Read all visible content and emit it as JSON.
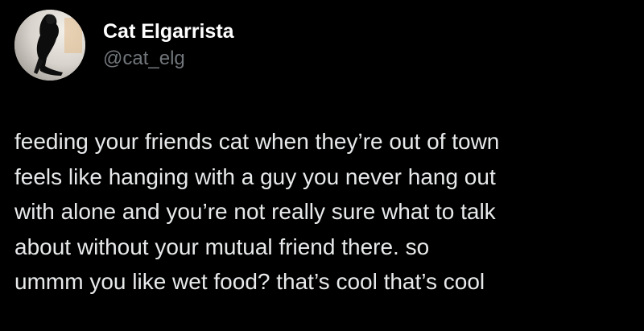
{
  "author": {
    "display_name": "Cat Elgarrista",
    "handle": "@cat_elg",
    "avatar_icon": "profile-photo-avatar"
  },
  "tweet": {
    "lines": [
      "feeding your friends cat when they’re out of town",
      "feels like hanging with a guy you never hang out",
      "with alone and you’re not really sure what to talk",
      "about without your mutual friend there. so",
      "ummm you like wet food? that’s cool that’s cool"
    ]
  },
  "colors": {
    "background": "#000000",
    "name": "#ffffff",
    "handle": "#71767b",
    "text": "#e7e9ea"
  }
}
